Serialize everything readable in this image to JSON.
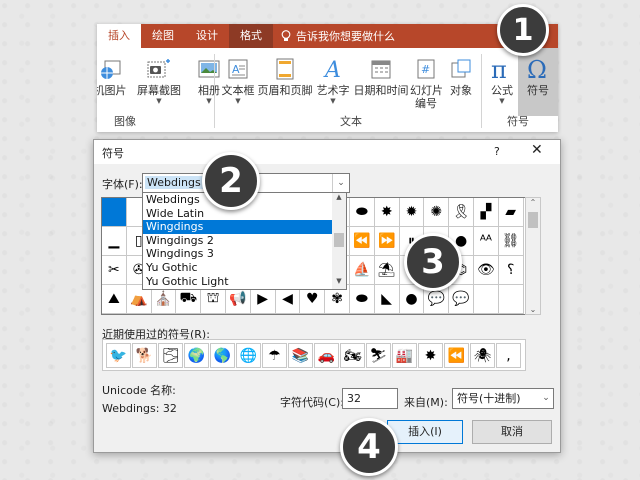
{
  "ribbon": {
    "tabs": [
      "插入",
      "绘图",
      "设计",
      "格式"
    ],
    "tell_me": "告诉我你想要做什么",
    "groups": {
      "images": "图像",
      "text": "文本",
      "symbols": "符号"
    },
    "buttons": {
      "online_pictures": "机图片",
      "screenshot": "屏幕截图",
      "album": "相册",
      "textbox": "文本框",
      "header_footer": "页眉和页脚",
      "wordart": "艺术字",
      "datetime": "日期和时间",
      "slide_number_1": "幻灯片",
      "slide_number_2": "编号",
      "object": "对象",
      "equation": "公式",
      "symbol": "符号"
    }
  },
  "dialog": {
    "title": "符号",
    "help": "?",
    "close": "✕",
    "font_label": "字体(F):",
    "font_value": "Webdings",
    "font_options": [
      "Webdings",
      "Wide Latin",
      "Wingdings",
      "Wingdings 2",
      "Wingdings 3",
      "Yu Gothic",
      "Yu Gothic Light"
    ],
    "font_selected_index": 2,
    "grid_symbols": [
      [
        "",
        "",
        "",
        "",
        "",
        "",
        "",
        "",
        "",
        "",
        "⬬",
        "✸",
        "✹",
        "✺",
        "🎗",
        "▞",
        "▰"
      ],
      [
        "▁",
        "▯",
        "",
        "",
        "",
        "",
        "",
        "",
        "",
        "",
        "⏪",
        "⏩",
        "⏸",
        "■",
        "●",
        "ᴬᴬ",
        "⛓"
      ],
      [
        "✂",
        "✇",
        "",
        "",
        "",
        "",
        "",
        "",
        "",
        "",
        "⛵",
        "⛱",
        "⛶",
        "❯",
        "⌬",
        "👁",
        "⸮"
      ],
      [
        "⛰",
        "⛺",
        "⛪",
        "⛟",
        "⛫",
        "📢",
        "▶",
        "◀",
        "♥",
        "✾",
        "⬬",
        "◣",
        "●",
        "💬",
        "💬",
        "",
        ""
      ]
    ],
    "recent_label": "近期使用过的符号(R):",
    "recent_symbols": [
      "🐦",
      "🐕",
      "🌫",
      "🌍",
      "🌎",
      "🌐",
      "☂",
      "📚",
      "🚗",
      "🏍",
      "⛷",
      "🏭",
      "✸",
      "⏪",
      "🕷",
      ","
    ],
    "unicode_name_label": "Unicode 名称:",
    "unicode_name_value": "Webdings: 32",
    "char_code_label": "字符代码(C):",
    "char_code_value": "32",
    "from_label": "来自(M):",
    "from_value": "符号(十进制)",
    "insert_button": "插入(I)",
    "cancel_button": "取消"
  },
  "badges": [
    "1",
    "2",
    "3",
    "4"
  ],
  "colors": {
    "accent": "#b7472a",
    "selection": "#0078d7"
  }
}
